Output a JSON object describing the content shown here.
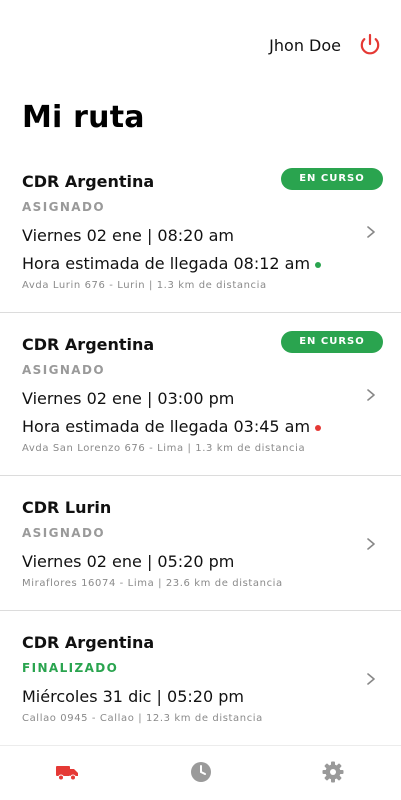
{
  "header": {
    "user_name": "Jhon Doe",
    "power_icon": "power-icon",
    "power_color": "#e53935"
  },
  "page": {
    "title": "Mi ruta"
  },
  "colors": {
    "accent_green": "#2aa44f",
    "accent_red": "#e53935",
    "tab_active": "#e53935",
    "tab_inactive": "#9a9a9a"
  },
  "cards": [
    {
      "name": "CDR Argentina",
      "badge": "EN CURSO",
      "status": "ASIGNADO",
      "datetime": "Viernes 02 ene | 08:20 am",
      "eta": "Hora estimada de llegada 08:12 am",
      "eta_dot_color": "#2aa44f",
      "address": "Avda Lurin 676 - Lurin | 1.3 km de distancia"
    },
    {
      "name": "CDR Argentina",
      "badge": "EN CURSO",
      "status": "ASIGNADO",
      "datetime": "Viernes 02 ene | 03:00 pm",
      "eta": "Hora estimada de llegada 03:45 am",
      "eta_dot_color": "#e53935",
      "address": "Avda San Lorenzo 676 - Lima | 1.3 km de distancia"
    },
    {
      "name": "CDR Lurin",
      "status": "ASIGNADO",
      "datetime": "Viernes 02 ene | 05:20 pm",
      "address": "Miraflores 16074 - Lima | 23.6 km de distancia"
    },
    {
      "name": "CDR Argentina",
      "status": "FINALIZADO",
      "datetime": "Miércoles 31 dic | 05:20 pm",
      "address": "Callao 0945 - Callao | 12.3 km de distancia"
    }
  ],
  "tabbar": {
    "items": [
      "truck-icon",
      "clock-icon",
      "gear-icon"
    ],
    "active": "truck-icon"
  }
}
